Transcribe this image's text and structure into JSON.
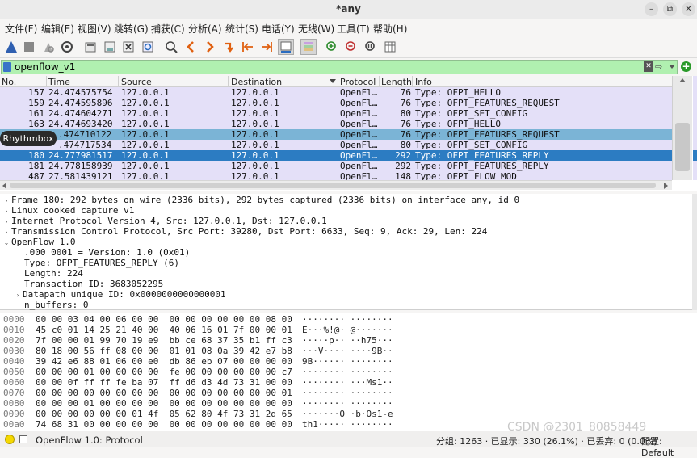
{
  "window": {
    "title": "*any",
    "minimize": "–",
    "maximize": "⧉",
    "close": "✕"
  },
  "menu": [
    "文件(F)",
    "编辑(E)",
    "视图(V)",
    "跳转(G)",
    "捕获(C)",
    "分析(A)",
    "统计(S)",
    "电话(Y)",
    "无线(W)",
    "工具(T)",
    "帮助(H)"
  ],
  "toolbar": {
    "icons": [
      "shark-fin-start-icon",
      "stop-icon",
      "restart-icon",
      "capture-options-icon",
      "open-file-icon",
      "save-file-icon",
      "close-file-icon",
      "reload-icon",
      "find-packet-icon",
      "go-back-icon",
      "go-forward-icon",
      "go-to-packet-icon",
      "go-first-icon",
      "go-last-icon",
      "autoscroll-icon",
      "colorize-icon",
      "zoom-in-icon",
      "zoom-out-icon",
      "zoom-normal-icon",
      "resize-columns-icon"
    ]
  },
  "filter": {
    "value": "openflow_v1",
    "clear": "✕",
    "apply": "⇨",
    "add": "+"
  },
  "packet_list": {
    "headers": [
      "No.",
      "Time",
      "Source",
      "Destination",
      "Protocol",
      "Length",
      "Info"
    ],
    "rows": [
      {
        "no": "157",
        "time": "24.474575754",
        "src": "127.0.0.1",
        "dst": "127.0.0.1",
        "proto": "OpenFl…",
        "len": "76",
        "info": "Type: OFPT_HELLO"
      },
      {
        "no": "159",
        "time": "24.474595896",
        "src": "127.0.0.1",
        "dst": "127.0.0.1",
        "proto": "OpenFl…",
        "len": "76",
        "info": "Type: OFPT_FEATURES_REQUEST"
      },
      {
        "no": "161",
        "time": "24.474604271",
        "src": "127.0.0.1",
        "dst": "127.0.0.1",
        "proto": "OpenFl…",
        "len": "80",
        "info": "Type: OFPT_SET_CONFIG"
      },
      {
        "no": "163",
        "time": "24.474693420",
        "src": "127.0.0.1",
        "dst": "127.0.0.1",
        "proto": "OpenFl…",
        "len": "76",
        "info": "Type: OFPT_HELLO"
      },
      {
        "no": "",
        "time": ".474710122",
        "src": "127.0.0.1",
        "dst": "127.0.0.1",
        "proto": "OpenFl…",
        "len": "76",
        "info": "Type: OFPT_FEATURES_REQUEST"
      },
      {
        "no": "",
        "time": ".474717534",
        "src": "127.0.0.1",
        "dst": "127.0.0.1",
        "proto": "OpenFl…",
        "len": "80",
        "info": "Type: OFPT_SET_CONFIG"
      },
      {
        "no": "180",
        "time": "24.777981517",
        "src": "127.0.0.1",
        "dst": "127.0.0.1",
        "proto": "OpenFl…",
        "len": "292",
        "info": "Type: OFPT_FEATURES_REPLY"
      },
      {
        "no": "181",
        "time": "24.778158939",
        "src": "127.0.0.1",
        "dst": "127.0.0.1",
        "proto": "OpenFl…",
        "len": "292",
        "info": "Type: OFPT_FEATURES_REPLY"
      },
      {
        "no": "487",
        "time": "27.581439121",
        "src": "127.0.0.1",
        "dst": "127.0.0.1",
        "proto": "OpenFl…",
        "len": "148",
        "info": "Type: OFPT_FLOW_MOD"
      }
    ]
  },
  "tooltip": "Rhythmbox",
  "details": [
    {
      "tri": "›",
      "text": "Frame 180: 292 bytes on wire (2336 bits), 292 bytes captured (2336 bits) on interface any, id 0"
    },
    {
      "tri": "›",
      "text": "Linux cooked capture v1"
    },
    {
      "tri": "›",
      "text": "Internet Protocol Version 4, Src: 127.0.0.1, Dst: 127.0.0.1"
    },
    {
      "tri": "›",
      "text": "Transmission Control Protocol, Src Port: 39280, Dst Port: 6633, Seq: 9, Ack: 29, Len: 224"
    },
    {
      "tri": "⌄",
      "text": "OpenFlow 1.0"
    },
    {
      "tri": "",
      "text": ".000 0001 = Version: 1.0 (0x01)"
    },
    {
      "tri": "",
      "text": "Type: OFPT_FEATURES_REPLY (6)"
    },
    {
      "tri": "",
      "text": "Length: 224"
    },
    {
      "tri": "",
      "text": "Transaction ID: 3683052295"
    },
    {
      "tri": "›",
      "text": "Datapath unique ID: 0x0000000000000001"
    },
    {
      "tri": "",
      "text": "n_buffers: 0"
    }
  ],
  "bytes": [
    {
      "off": "0000",
      "hex": "00 00 03 04 00 06 00 00  00 00 00 00 00 00 08 00",
      "ascii": "········ ········"
    },
    {
      "off": "0010",
      "hex": "45 c0 01 14 25 21 40 00  40 06 16 01 7f 00 00 01",
      "ascii": "E···%!@· @·······"
    },
    {
      "off": "0020",
      "hex": "7f 00 00 01 99 70 19 e9  bb ce 68 37 35 b1 ff c3",
      "ascii": "·····p·· ··h75···"
    },
    {
      "off": "0030",
      "hex": "80 18 00 56 ff 08 00 00  01 01 08 0a 39 42 e7 b8",
      "ascii": "···V···· ····9B··"
    },
    {
      "off": "0040",
      "hex": "39 42 e6 88 01 06 00 e0  db 86 eb 07 00 00 00 00",
      "ascii": "9B······ ········"
    },
    {
      "off": "0050",
      "hex": "00 00 00 01 00 00 00 00  fe 00 00 00 00 00 00 c7",
      "ascii": "········ ········"
    },
    {
      "off": "0060",
      "hex": "00 00 0f ff ff fe ba 07  ff d6 d3 4d 73 31 00 00",
      "ascii": "········ ···Ms1··"
    },
    {
      "off": "0070",
      "hex": "00 00 00 00 00 00 00 00  00 00 00 00 00 00 00 01",
      "ascii": "········ ········"
    },
    {
      "off": "0080",
      "hex": "00 00 00 01 00 00 00 00  00 00 00 00 00 00 00 00",
      "ascii": "········ ········"
    },
    {
      "off": "0090",
      "hex": "00 00 00 00 00 00 01 4f  05 62 80 4f 73 31 2d 65",
      "ascii": "·······O ·b·Os1-e"
    },
    {
      "off": "00a0",
      "hex": "74 68 31 00 00 00 00 00  00 00 00 00 00 00 00 00",
      "ascii": "th1····· ········"
    }
  ],
  "status": {
    "expert_color": "#f5d800",
    "protocol": "OpenFlow 1.0: Protocol",
    "counts": "分组: 1263 · 已显示: 330 (26.1%) · 已丢弃: 0 (0.0%)",
    "profile": "配置: Default"
  },
  "watermark": "CSDN @2301_80858449"
}
